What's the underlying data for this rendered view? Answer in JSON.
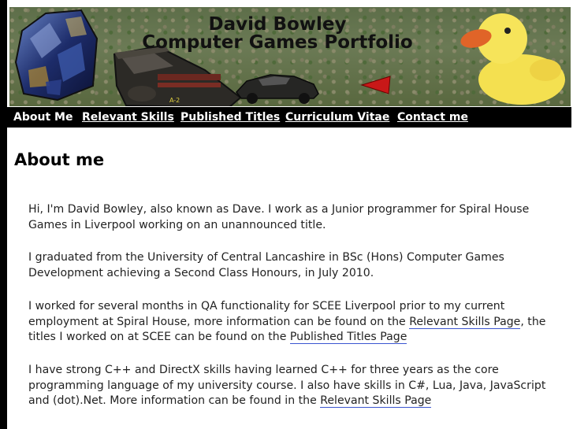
{
  "site": {
    "title_line1": "David Bowley",
    "title_line2": "Computer Games Portfolio",
    "unit_label": "A-2"
  },
  "nav": {
    "items": [
      {
        "label": "About Me"
      },
      {
        "label": "Relevant Skills"
      },
      {
        "label": "Published Titles"
      },
      {
        "label": "Curriculum Vitae"
      },
      {
        "label": "Contact me"
      }
    ]
  },
  "main": {
    "title": "About me",
    "p1": "Hi, I'm David Bowley, also known as Dave. I work as a Junior programmer for Spiral House Games in Liverpool working on an unannounced title.",
    "p2": "I graduated from the University of Central Lancashire in BSc (Hons) Computer Games Development achieving a Second Class Honours, in July 2010.",
    "p3_a": "I worked for several months in QA functionality for SCEE Liverpool prior to my current employment at Spiral House, more information can be found on the ",
    "p3_link1": "Relevant Skills Page",
    "p3_b": ", the titles I worked on at SCEE can be found on the ",
    "p3_link2": "Published Titles Page",
    "p4_a": "I have strong C++ and DirectX skills having learned C++ for three years as the core programming language of my university course. I also have skills in C#, Lua, Java, JavaScript and (dot).Net. More information can be found in the ",
    "p4_link": "Relevant Skills Page"
  },
  "colors": {
    "nav_bg": "#000000",
    "link_underline": "#3a55d0"
  }
}
